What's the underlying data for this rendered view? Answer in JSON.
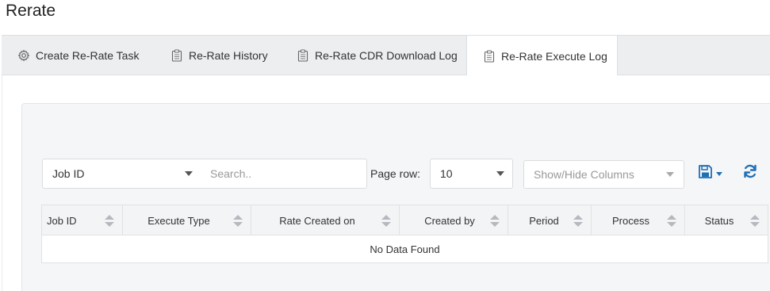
{
  "page": {
    "title": "Rerate"
  },
  "tabs": [
    {
      "label": "Create Re-Rate Task",
      "icon": "gear-icon",
      "active": false
    },
    {
      "label": "Re-Rate History",
      "icon": "clipboard-icon",
      "active": false
    },
    {
      "label": "Re-Rate CDR Download Log",
      "icon": "clipboard-icon",
      "active": false
    },
    {
      "label": "Re-Rate Execute Log",
      "icon": "clipboard-icon",
      "active": true
    }
  ],
  "filter": {
    "field_value": "Job ID",
    "search_placeholder": "Search..",
    "page_row_label": "Page row:",
    "page_row_value": "10",
    "columns_placeholder": "Show/Hide Columns"
  },
  "table": {
    "columns": [
      "Job ID",
      "Execute Type",
      "Rate Created on",
      "Created by",
      "Period",
      "Process",
      "Status"
    ],
    "empty_message": "No Data Found"
  },
  "colors": {
    "accent": "#1f6fb5",
    "tab_bg": "#eceef0",
    "card_bg": "#f5f6f8"
  }
}
